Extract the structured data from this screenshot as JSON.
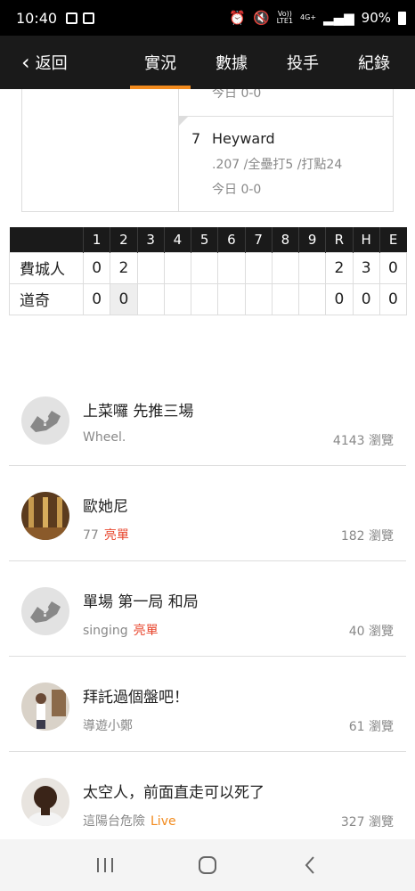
{
  "status_bar": {
    "time": "10:40",
    "network_top": "Vo))",
    "network_bottom": "LTE1",
    "data_type": "4G+",
    "battery": "90%"
  },
  "header": {
    "back_label": "返回",
    "tabs": [
      {
        "label": "實況",
        "active": true
      },
      {
        "label": "數據",
        "active": false
      },
      {
        "label": "投手",
        "active": false
      },
      {
        "label": "紀錄",
        "active": false
      }
    ]
  },
  "lineup": {
    "partial_text": "今日 0-0",
    "player": {
      "number": "7",
      "name": "Heyward",
      "stats": ".207 /全壘打5 /打點24",
      "today": "今日 0-0"
    }
  },
  "scoreboard": {
    "headers": [
      "",
      "1",
      "2",
      "3",
      "4",
      "5",
      "6",
      "7",
      "8",
      "9",
      "R",
      "H",
      "E"
    ],
    "rows": [
      {
        "team": "費城人",
        "innings": [
          "0",
          "2",
          "",
          "",
          "",
          "",
          "",
          "",
          ""
        ],
        "r": "2",
        "h": "3",
        "e": "0"
      },
      {
        "team": "道奇",
        "innings": [
          "0",
          "0",
          "",
          "",
          "",
          "",
          "",
          "",
          ""
        ],
        "r": "0",
        "h": "0",
        "e": "0"
      }
    ]
  },
  "posts": [
    {
      "title": "上菜囉 先推三場",
      "author": "Wheel.",
      "badge": "",
      "views": "4143 瀏覽",
      "avatar": "default-avatar-icon"
    },
    {
      "title": "歐她尼",
      "author": "77",
      "badge": "亮單",
      "views": "182 瀏覽",
      "avatar": "user-photo"
    },
    {
      "title": "單場 第一局 和局",
      "author": "singing",
      "badge": "亮單",
      "views": "40 瀏覽",
      "avatar": "default-avatar-icon"
    },
    {
      "title": "拜託過個盤吧！",
      "author": "導遊小鄭",
      "badge": "",
      "views": "61 瀏覽",
      "avatar": "user-photo"
    },
    {
      "title": "太空人，前面直走可以死了",
      "author": "這陽台危險",
      "badge": "Live",
      "views": "327 瀏覽",
      "avatar": "user-photo"
    }
  ],
  "colors": {
    "accent": "#f28a1c",
    "header_bg": "#1a1a1a",
    "badge_red": "#e8452c"
  }
}
